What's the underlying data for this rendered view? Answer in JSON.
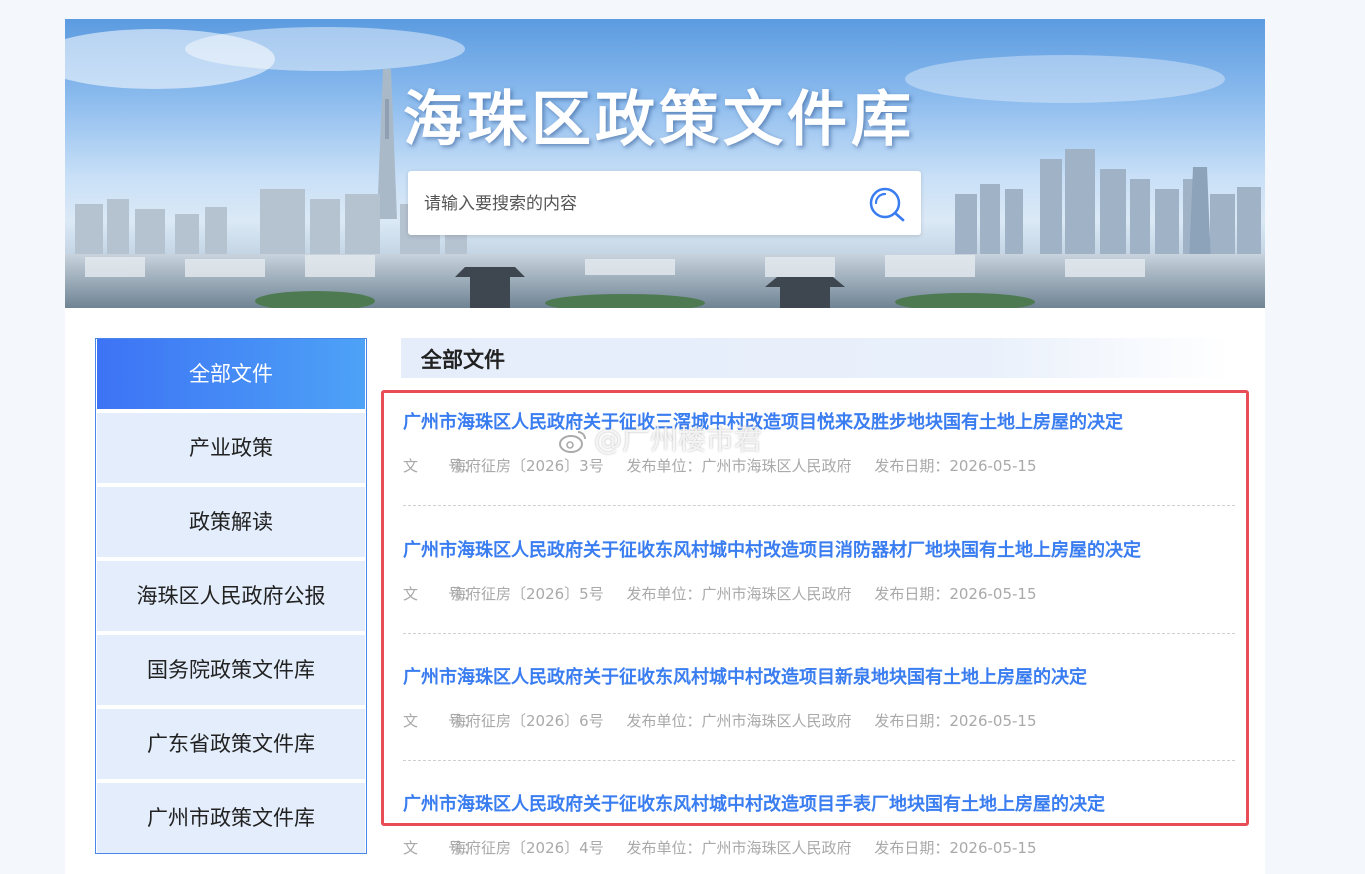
{
  "banner": {
    "title": "海珠区政策文件库",
    "search_placeholder": "请输入要搜索的内容"
  },
  "sidebar": {
    "items": [
      {
        "label": "全部文件",
        "active": true
      },
      {
        "label": "产业政策",
        "active": false
      },
      {
        "label": "政策解读",
        "active": false
      },
      {
        "label": "海珠区人民政府公报",
        "active": false
      },
      {
        "label": "国务院政策文件库",
        "active": false
      },
      {
        "label": "广东省政策文件库",
        "active": false
      },
      {
        "label": "广州市政策文件库",
        "active": false
      }
    ]
  },
  "main": {
    "heading": "全部文件",
    "documents": [
      {
        "title": "广州市海珠区人民政府关于征收三滘城中村改造项目悦来及胜步地块国有土地上房屋的决定",
        "doc_no_label": "文　　号：",
        "doc_no": "海府征房〔2026〕3号",
        "publisher_label": "发布单位：",
        "publisher": "广州市海珠区人民政府",
        "date_label": "发布日期：",
        "date": "2026-05-15"
      },
      {
        "title": "广州市海珠区人民政府关于征收东风村城中村改造项目消防器材厂地块国有土地上房屋的决定",
        "doc_no_label": "文　　号：",
        "doc_no": "海府征房〔2026〕5号",
        "publisher_label": "发布单位：",
        "publisher": "广州市海珠区人民政府",
        "date_label": "发布日期：",
        "date": "2026-05-15"
      },
      {
        "title": "广州市海珠区人民政府关于征收东风村城中村改造项目新泉地块国有土地上房屋的决定",
        "doc_no_label": "文　　号：",
        "doc_no": "海府征房〔2026〕6号",
        "publisher_label": "发布单位：",
        "publisher": "广州市海珠区人民政府",
        "date_label": "发布日期：",
        "date": "2026-05-15"
      },
      {
        "title": "广州市海珠区人民政府关于征收东风村城中村改造项目手表厂地块国有土地上房屋的决定",
        "doc_no_label": "文　　号：",
        "doc_no": "海府征房〔2026〕4号",
        "publisher_label": "发布单位：",
        "publisher": "广州市海珠区人民政府",
        "date_label": "发布日期：",
        "date": "2026-05-15"
      }
    ]
  },
  "watermark": "@广州楼市君",
  "colors": {
    "accent": "#3a7df0",
    "sidebar_active": "#4a86e8",
    "sidebar_bg": "#e3edfb",
    "highlight": "#e84c54"
  }
}
